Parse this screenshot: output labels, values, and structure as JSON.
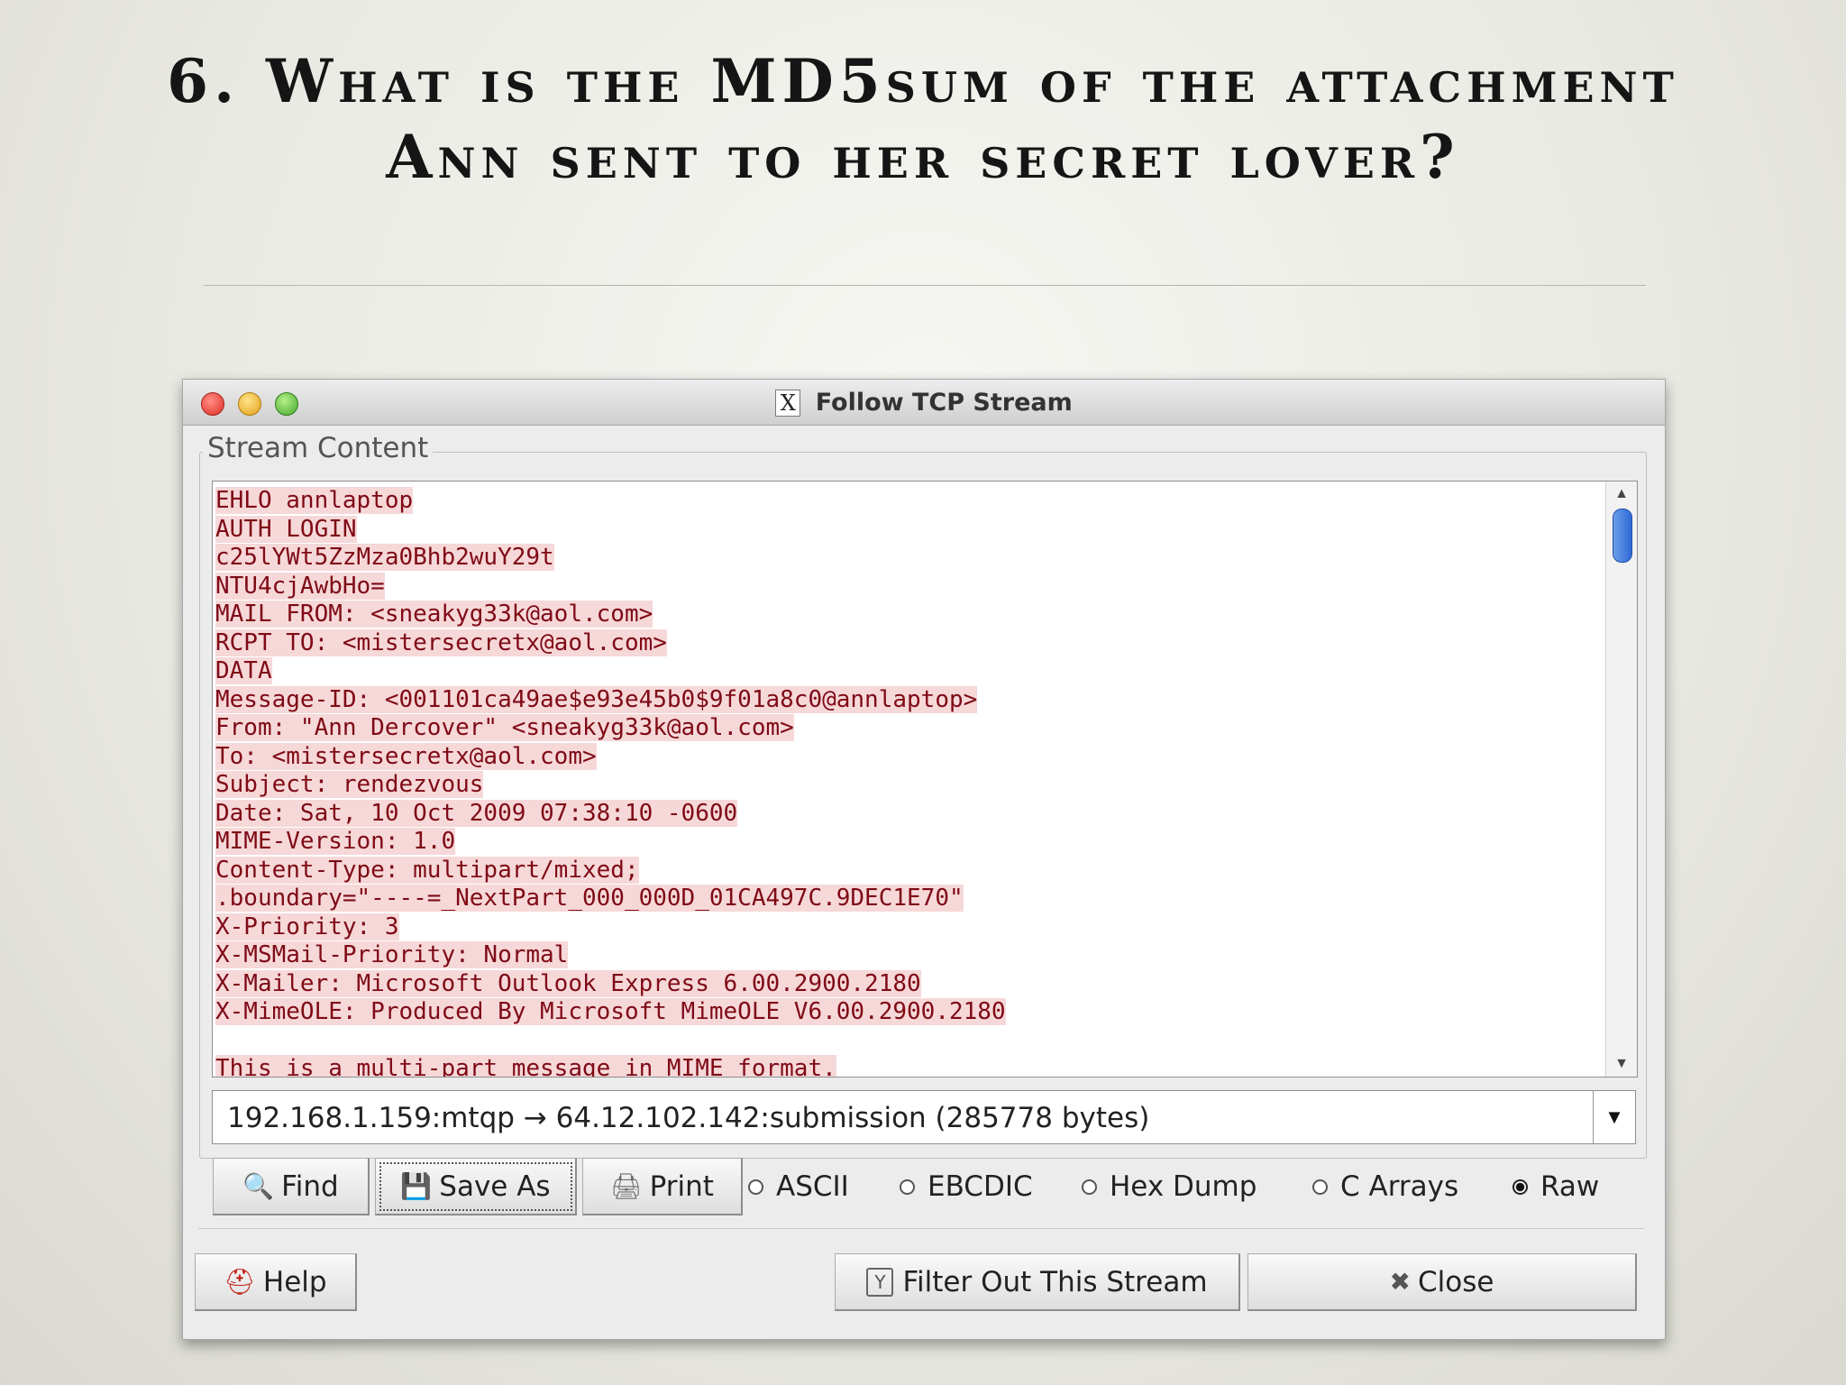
{
  "slide": {
    "title": "6. What is the MD5sum of the attachment Ann sent to her secret lover?"
  },
  "window": {
    "title": "Follow TCP Stream",
    "group_label": "Stream Content"
  },
  "stream": {
    "lines": [
      "EHLO annlaptop",
      "AUTH LOGIN",
      "c25lYWt5ZzMza0Bhb2wuY29t",
      "NTU4cjAwbHo=",
      "MAIL FROM: <sneakyg33k@aol.com>",
      "RCPT TO: <mistersecretx@aol.com>",
      "DATA",
      "Message-ID: <001101ca49ae$e93e45b0$9f01a8c0@annlaptop>",
      "From: \"Ann Dercover\" <sneakyg33k@aol.com>",
      "To: <mistersecretx@aol.com>",
      "Subject: rendezvous",
      "Date: Sat, 10 Oct 2009 07:38:10 -0600",
      "MIME-Version: 1.0",
      "Content-Type: multipart/mixed;",
      ".boundary=\"----=_NextPart_000_000D_01CA497C.9DEC1E70\"",
      "X-Priority: 3",
      "X-MSMail-Priority: Normal",
      "X-Mailer: Microsoft Outlook Express 6.00.2900.2180",
      "X-MimeOLE: Produced By Microsoft MimeOLE V6.00.2900.2180",
      "",
      "This is a multi-part message in MIME format."
    ]
  },
  "conversation": {
    "selected": "192.168.1.159:mtqp → 64.12.102.142:submission (285778 bytes)"
  },
  "buttons": {
    "find": "Find",
    "save_as": "Save As",
    "print": "Print",
    "help": "Help",
    "filter": "Filter Out This Stream",
    "close": "Close"
  },
  "formats": {
    "ascii": "ASCII",
    "ebcdic": "EBCDIC",
    "hex_dump": "Hex Dump",
    "c_arrays": "C Arrays",
    "raw": "Raw",
    "selected": "Raw"
  },
  "icons": {
    "find": "magnifier-icon",
    "save": "save-icon",
    "print": "printer-icon",
    "help": "lifebuoy-icon",
    "filter": "filter-icon",
    "close": "close-x-icon",
    "title": "x11-icon"
  },
  "colors": {
    "stream_text": "#7f0a16",
    "stream_highlight": "#f6d8d8",
    "scroll_thumb": "#2f6ad6"
  }
}
